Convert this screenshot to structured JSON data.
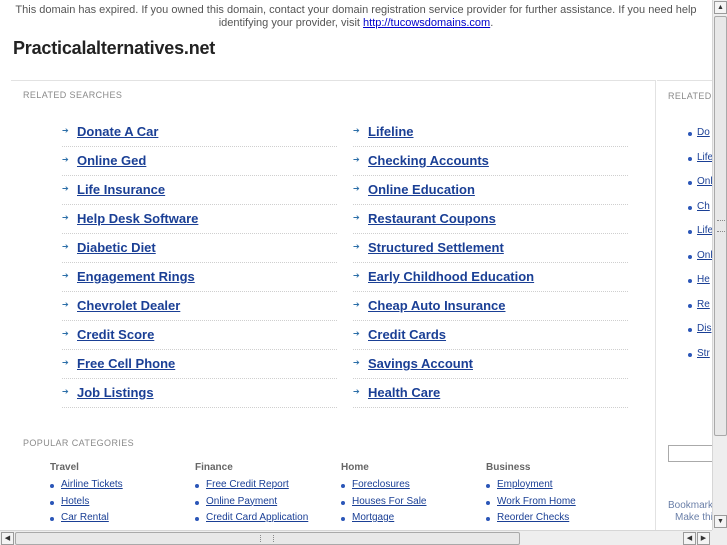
{
  "notice": {
    "text_before": "This domain has expired. If you owned this domain, contact your domain registration service provider for further assistance. If you need help identifying your provider, visit ",
    "link": "http://tucowsdomains.com",
    "text_after": "."
  },
  "site_title": "Practicalalternatives.net",
  "related_searches": {
    "label": "RELATED SEARCHES",
    "left": [
      "Donate A Car",
      "Online Ged",
      "Life Insurance",
      "Help Desk Software",
      "Diabetic Diet",
      "Engagement Rings",
      "Chevrolet Dealer",
      "Credit Score",
      "Free Cell Phone",
      "Job Listings"
    ],
    "right": [
      "Lifeline",
      "Checking Accounts",
      "Online Education",
      "Restaurant Coupons",
      "Structured Settlement",
      "Early Childhood Education",
      "Cheap Auto Insurance",
      "Credit Cards",
      "Savings Account",
      "Health Care"
    ]
  },
  "popular_categories": {
    "label": "POPULAR CATEGORIES",
    "columns": [
      {
        "heading": "Travel",
        "items": [
          "Airline Tickets",
          "Hotels",
          "Car Rental"
        ]
      },
      {
        "heading": "Finance",
        "items": [
          "Free Credit Report",
          "Online Payment",
          "Credit Card Application"
        ]
      },
      {
        "heading": "Home",
        "items": [
          "Foreclosures",
          "Houses For Sale",
          "Mortgage"
        ]
      },
      {
        "heading": "Business",
        "items": [
          "Employment",
          "Work From Home",
          "Reorder Checks"
        ]
      }
    ]
  },
  "side_panel": {
    "label": "RELATED",
    "items": [
      "Do",
      "Life",
      "Onl",
      "Ch",
      "Life",
      "Onl",
      "He",
      "Re",
      "Dis",
      "Str"
    ],
    "bookmark_line1": "Bookmark",
    "bookmark_line2": "Make thi"
  },
  "colors": {
    "link": "#1a3f95",
    "arrow": "#2b6ea8",
    "label": "#8a8a8a"
  },
  "icons": {
    "arrow": "right-arrow-icon",
    "bullet": "bullet-icon"
  }
}
